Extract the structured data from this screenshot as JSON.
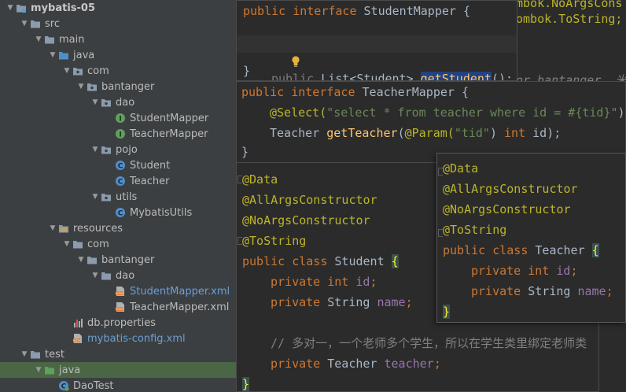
{
  "project_tree": {
    "items": [
      {
        "label": "mybatis-05",
        "depth": 0,
        "expanded": true,
        "icon": "module-folder-icon",
        "style": "bold"
      },
      {
        "label": "src",
        "depth": 1,
        "expanded": true,
        "icon": "folder-icon"
      },
      {
        "label": "main",
        "depth": 2,
        "expanded": true,
        "icon": "folder-icon"
      },
      {
        "label": "java",
        "depth": 3,
        "expanded": true,
        "icon": "source-folder-icon"
      },
      {
        "label": "com",
        "depth": 4,
        "expanded": true,
        "icon": "package-icon"
      },
      {
        "label": "bantanger",
        "depth": 5,
        "expanded": true,
        "icon": "package-icon"
      },
      {
        "label": "dao",
        "depth": 6,
        "expanded": true,
        "icon": "package-icon"
      },
      {
        "label": "StudentMapper",
        "depth": 7,
        "expanded": null,
        "icon": "interface-icon"
      },
      {
        "label": "TeacherMapper",
        "depth": 7,
        "expanded": null,
        "icon": "interface-icon"
      },
      {
        "label": "pojo",
        "depth": 6,
        "expanded": true,
        "icon": "package-icon"
      },
      {
        "label": "Student",
        "depth": 7,
        "expanded": null,
        "icon": "class-icon"
      },
      {
        "label": "Teacher",
        "depth": 7,
        "expanded": null,
        "icon": "class-icon"
      },
      {
        "label": "utils",
        "depth": 6,
        "expanded": true,
        "icon": "package-icon"
      },
      {
        "label": "MybatisUtils",
        "depth": 7,
        "expanded": null,
        "icon": "class-icon"
      },
      {
        "label": "resources",
        "depth": 3,
        "expanded": true,
        "icon": "resources-folder-icon"
      },
      {
        "label": "com",
        "depth": 4,
        "expanded": true,
        "icon": "folder-icon"
      },
      {
        "label": "bantanger",
        "depth": 5,
        "expanded": true,
        "icon": "folder-icon"
      },
      {
        "label": "dao",
        "depth": 6,
        "expanded": true,
        "icon": "folder-icon"
      },
      {
        "label": "StudentMapper.xml",
        "depth": 7,
        "expanded": null,
        "icon": "xml-file-icon",
        "style": "blue"
      },
      {
        "label": "TeacherMapper.xml",
        "depth": 7,
        "expanded": null,
        "icon": "xml-file-icon"
      },
      {
        "label": "db.properties",
        "depth": 4,
        "expanded": null,
        "icon": "properties-file-icon"
      },
      {
        "label": "mybatis-config.xml",
        "depth": 4,
        "expanded": null,
        "icon": "xml-file-icon",
        "style": "blue"
      },
      {
        "label": "test",
        "depth": 1,
        "expanded": true,
        "icon": "folder-icon"
      },
      {
        "label": "java",
        "depth": 2,
        "expanded": true,
        "icon": "test-source-folder-icon",
        "selected": true
      },
      {
        "label": "DaoTest",
        "depth": 3,
        "expanded": null,
        "icon": "test-class-icon"
      }
    ]
  },
  "student_mapper": {
    "line1": {
      "kw": "public interface ",
      "name": "StudentMapper",
      "rest": " {"
    },
    "line2": {
      "kw": "public ",
      "type": "List<Student> ",
      "method": "getStudent",
      "rest": "();"
    },
    "line3": "}"
  },
  "teacher_mapper": {
    "line1": {
      "kw": "public interface ",
      "name": "TeacherMapper",
      "rest": " {"
    },
    "line2": {
      "anno": "@Select(",
      "str": "\"select * from teacher where id = #{tid}\"",
      "rest": ")"
    },
    "line3": {
      "type": "Teacher ",
      "method": "getTeacher",
      "p1": "(",
      "anno": "@Param(",
      "str": "\"tid\"",
      "p2": ") ",
      "kw": "int",
      "rest": " id);"
    },
    "line4": "}"
  },
  "student_class": {
    "annotations": [
      "@Data",
      "@AllArgsConstructor",
      "@NoArgsConstructor",
      "@ToString"
    ],
    "decl": {
      "kw": "public class ",
      "name": "Student ",
      "brace": "{"
    },
    "fields": [
      {
        "kw": "private ",
        "type_kw": "int ",
        "type": "",
        "name": "id",
        ";": ";"
      },
      {
        "kw": "private ",
        "type_kw": "",
        "type": "String ",
        "name": "name",
        ";": ";"
      }
    ],
    "comment": "// 多对一，一个老师多个学生，所以在学生类里绑定老师类",
    "assoc": {
      "kw": "private ",
      "type": "Teacher ",
      "name": "teacher",
      "end": ";"
    },
    "close": "}"
  },
  "teacher_class": {
    "annotations": [
      "@Data",
      "@AllArgsConstructor",
      "@NoArgsConstructor",
      "@ToString"
    ],
    "decl": {
      "kw": "public class ",
      "name": "Teacher ",
      "brace": "{"
    },
    "fields": [
      {
        "kw": "private ",
        "type_kw": "int ",
        "type": "",
        "name": "id",
        ";": ";"
      },
      {
        "kw": "private ",
        "type_kw": "",
        "type": "String ",
        "name": "name",
        ";": ";"
      }
    ],
    "close": "}"
  },
  "background_fragments": {
    "top_right_1": "mbok.NoArgsCons",
    "top_right_2": "ombok.ToString;",
    "mid_right": "or bantanger  米搏"
  }
}
